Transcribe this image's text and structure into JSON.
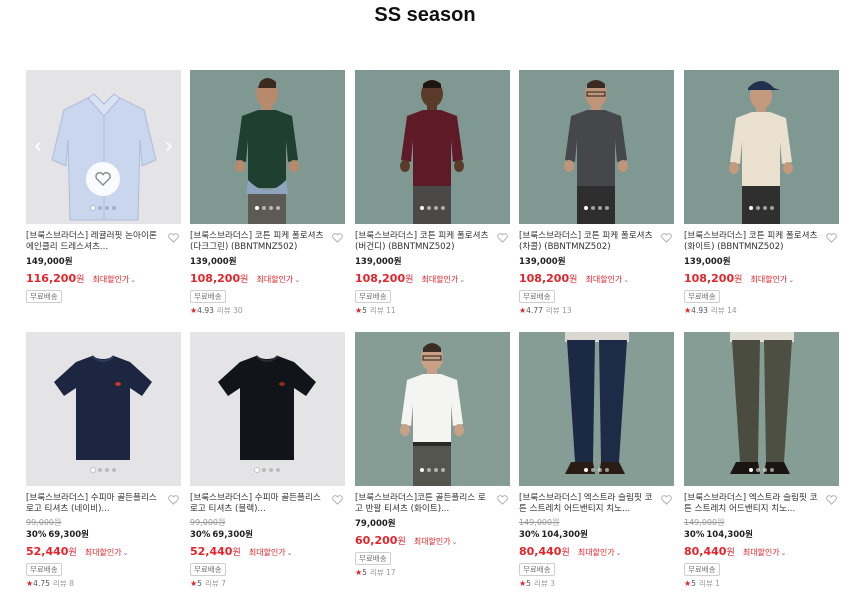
{
  "page_title": "SS season",
  "free_shipping": "무료배송",
  "max_discount_label": "최대할인가",
  "won": "원",
  "review_label": "리뷰",
  "colors": {
    "sale": "#e4242b",
    "star": "#e4242b"
  },
  "products": [
    {
      "name": "[브룩스브라더스] 레귤러핏 논아이론 에인클리 드레스셔츠...",
      "original": "",
      "discount": "",
      "price": "149,000원",
      "sale": "116,200",
      "rating": "",
      "reviews": "",
      "image": "light-blue-dress-shirt"
    },
    {
      "name": "[브룩스브라더스] 코튼 피케 폴로셔츠 (다크그린) (BBNTMNZ502)",
      "original": "",
      "discount": "",
      "price": "139,000원",
      "sale": "108,200",
      "rating": "4.93",
      "reviews": "30",
      "image": "model-green-polo"
    },
    {
      "name": "[브룩스브라더스] 코튼 피케 폴로셔츠 (버건디) (BBNTMNZ502)",
      "original": "",
      "discount": "",
      "price": "139,000원",
      "sale": "108,200",
      "rating": "5",
      "reviews": "11",
      "image": "model-burgundy-polo"
    },
    {
      "name": "[브룩스브라더스] 코튼 피케 폴로셔츠 (차콜) (BBNTMNZ502)",
      "original": "",
      "discount": "",
      "price": "139,000원",
      "sale": "108,200",
      "rating": "4.77",
      "reviews": "13",
      "image": "model-charcoal-polo"
    },
    {
      "name": "[브룩스브라더스] 코튼 피케 폴로셔츠 (화이트) (BBNTMNZ502)",
      "original": "",
      "discount": "",
      "price": "139,000원",
      "sale": "108,200",
      "rating": "4.93",
      "reviews": "14",
      "image": "model-white-polo"
    },
    {
      "name": "[브룩스브라더스] 수피마 골든플리스 로고 티셔츠 (네이비)...",
      "original": "99,000원",
      "discount": "30%",
      "price": "69,300원",
      "sale": "52,440",
      "rating": "4.75",
      "reviews": "8",
      "image": "navy-tshirt"
    },
    {
      "name": "[브룩스브라더스] 수피마 골든플리스 로고 티셔츠 (블랙)...",
      "original": "99,000원",
      "discount": "30%",
      "price": "69,300원",
      "sale": "52,440",
      "rating": "5",
      "reviews": "7",
      "image": "black-tshirt"
    },
    {
      "name": "[브룩스브라더스]코튼 골든플리스 로고 반팔 티셔츠 (화이트)...",
      "original": "",
      "discount": "",
      "price": "79,000원",
      "sale": "60,200",
      "rating": "5",
      "reviews": "17",
      "image": "model-white-tshirt"
    },
    {
      "name": "[브룩스브라더스] 엑스트라 슬림핏 코튼 스트레치 어드밴티지 치노...",
      "original": "149,000원",
      "discount": "30%",
      "price": "104,300원",
      "sale": "80,440",
      "rating": "5",
      "reviews": "3",
      "image": "navy-chino-legs"
    },
    {
      "name": "[브룩스브라더스] 엑스트라 슬림핏 코튼 스트레치 어드밴티지 치노...",
      "original": "149,000원",
      "discount": "30%",
      "price": "104,300원",
      "sale": "80,440",
      "rating": "5",
      "reviews": "1",
      "image": "olive-chino-legs"
    }
  ]
}
